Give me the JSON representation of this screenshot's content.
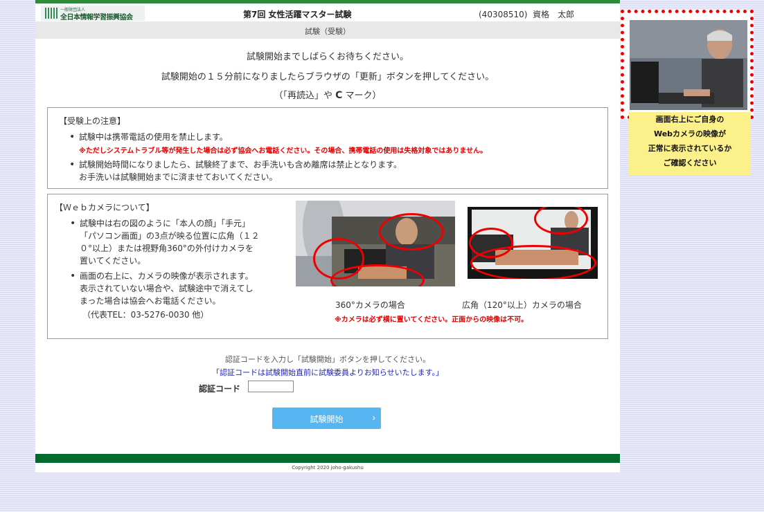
{
  "header": {
    "logo_small": "一般財団法人",
    "logo_name": "全日本情報学習振興協会",
    "exam_title": "第7回 女性活躍マスター試験",
    "user_id": "(40308510)",
    "user_name": "資格　太郎"
  },
  "subheader": {
    "title": "試験（受験）"
  },
  "intro": {
    "wait": "試験開始までしばらくお待ちください。",
    "refresh": "試験開始の１５分前になりましたらブラウザの「更新」ボタンを押してください。",
    "reload_prefix": "（「再読込」や",
    "reload_glyph": "C",
    "reload_suffix": "マーク）"
  },
  "notice": {
    "title": "【受験上の注意】",
    "item1": "試験中は携帯電話の使用を禁止します。",
    "item1_note": "※ただしシステムトラブル等が発生した場合は必ず協会へお電話ください。その場合、携帯電話の使用は失格対象ではありません。",
    "item2_line1": "試験開始時間になりましたら、試験終了まで、お手洗いも含め離席は禁止となります。",
    "item2_line2": "お手洗いは試験開始までに済ませておいてください。"
  },
  "camera": {
    "title": "【Ｗｅｂカメラについて】",
    "item1_lines": [
      "試験中は右の図のように「本人の顔」「手元」",
      "「パソコン画面」の3点が映る位置に広角（１２",
      "０°以上）または視野角360°の外付けカメラを",
      "置いてください。"
    ],
    "item2_lines": [
      "画面の右上に、カメラの映像が表示されます。",
      "表示されていない場合や、試験途中で消えてし",
      "まった場合は協会へお電話ください。"
    ],
    "tel": "（代表TEL：03-5276-0030 他）",
    "caption_360": "360°カメラの場合",
    "caption_wide": "広角（120°以上）カメラの場合",
    "caption_note": "※カメラは必ず横に置いてください。正面からの映像は不可。"
  },
  "auth": {
    "instruction": "認証コードを入力し「試験開始」ボタンを押してください。",
    "notice": "「認証コードは試験開始直前に試験委員よりお知らせいたします。」",
    "label": "認証コード",
    "value": "",
    "start_button": "試験開始"
  },
  "footer": {
    "copyright": "Copyright 2020 joho-gakushu"
  },
  "webcam_panel": {
    "line1": "画面右上にご自身の",
    "line2": "Webカメラの映像が",
    "line3": "正常に表示されているか",
    "line4": "ご確認ください"
  },
  "colors": {
    "header_green": "#2f8a3a",
    "footer_green": "#006b2a",
    "warning_red": "#e00000",
    "start_button": "#55b6f1",
    "panel_yellow": "#fcf08a"
  }
}
